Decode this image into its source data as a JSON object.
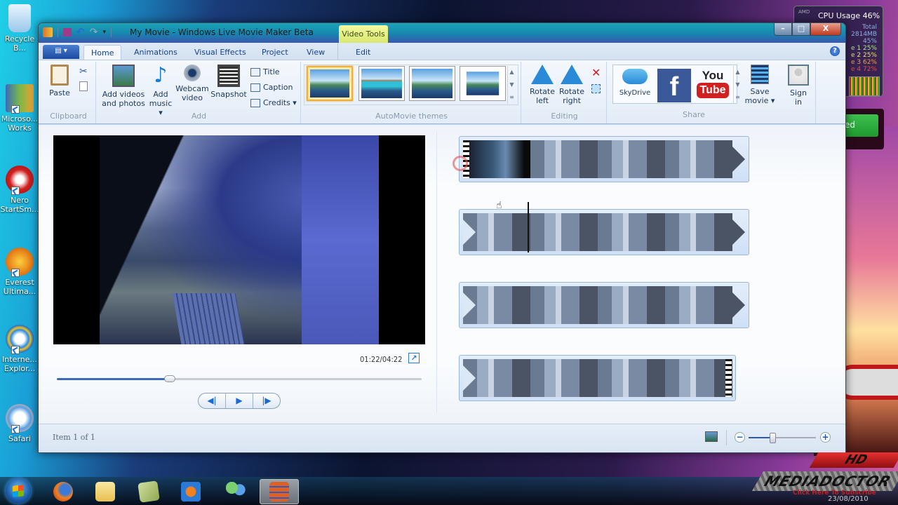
{
  "desktop": {
    "icons": [
      {
        "label": "Recycle B...",
        "icon": "recycle-bin-icon"
      },
      {
        "label": "Microso... Works",
        "icon": "ms-works-icon"
      },
      {
        "label": "Nero StartSm...",
        "icon": "nero-icon"
      },
      {
        "label": "Everest Ultima...",
        "icon": "everest-icon"
      },
      {
        "label": "Interne... Explor...",
        "icon": "internet-explorer-icon"
      },
      {
        "label": "Safari",
        "icon": "safari-icon"
      }
    ],
    "cpu_gadget": {
      "brand": "AMD",
      "title": "CPU Usage",
      "usage": "46%",
      "total_label": "Total",
      "memory": "2814MB",
      "mem_percent": "45%",
      "cores": [
        {
          "label": "e 1",
          "value": "25%",
          "color": "#a8e890"
        },
        {
          "label": "e 2",
          "value": "25%",
          "color": "#e8e070"
        },
        {
          "label": "e 3",
          "value": "62%",
          "color": "#f0a040"
        },
        {
          "label": "e 4",
          "value": "72%",
          "color": "#e05050"
        }
      ]
    },
    "green_gadget_text": "ed"
  },
  "window": {
    "title": "My Movie - Windows Live Movie Maker Beta",
    "context_tab_group": "Video Tools",
    "controls": {
      "minimize": "–",
      "maximize": "□",
      "close": "X"
    }
  },
  "tabs": [
    {
      "label": "Home",
      "active": true
    },
    {
      "label": "Animations",
      "active": false
    },
    {
      "label": "Visual Effects",
      "active": false
    },
    {
      "label": "Project",
      "active": false
    },
    {
      "label": "View",
      "active": false
    },
    {
      "label": "Edit",
      "active": false
    }
  ],
  "app_menu_label": "▤ ▾",
  "help_label": "?",
  "ribbon": {
    "clipboard": {
      "label": "Clipboard",
      "paste": "Paste"
    },
    "add": {
      "label": "Add",
      "add_videos": [
        "Add videos",
        "and photos"
      ],
      "add_music": [
        "Add",
        "music ▾"
      ],
      "webcam": [
        "Webcam",
        "video"
      ],
      "snapshot": "Snapshot",
      "title": "Title",
      "caption": "Caption",
      "credits": "Credits ▾"
    },
    "themes": {
      "label": "AutoMovie themes",
      "count": 4,
      "selected_index": 0
    },
    "editing": {
      "label": "Editing",
      "rotate_left": [
        "Rotate",
        "left"
      ],
      "rotate_right": [
        "Rotate",
        "right"
      ]
    },
    "share": {
      "label": "Share",
      "skydrive": "SkyDrive",
      "facebook": "f",
      "youtube": [
        "You",
        "Tube"
      ],
      "save_movie": [
        "Save",
        "movie ▾"
      ],
      "sign_in": [
        "Sign",
        "in"
      ]
    }
  },
  "preview": {
    "timecode": "01:22/04:22",
    "progress": 0.31
  },
  "transport": {
    "prev": "◀|",
    "play": "▶",
    "next": "|▶"
  },
  "storyboard": {
    "clips": 4,
    "playhead_clip": 2
  },
  "status": {
    "item_text": "Item 1 of 1",
    "zoom_level": 0.35
  },
  "taskbar": {
    "items": [
      "firefox",
      "windows-explorer",
      "sticky-app",
      "media-player",
      "messenger",
      "movie-maker"
    ],
    "active": "movie-maker"
  },
  "watermark": {
    "hd": "HD",
    "brand": "MEDIADOCTOR",
    "subscribe": "Click Here To Subscribe",
    "date": "23/08/2010"
  }
}
